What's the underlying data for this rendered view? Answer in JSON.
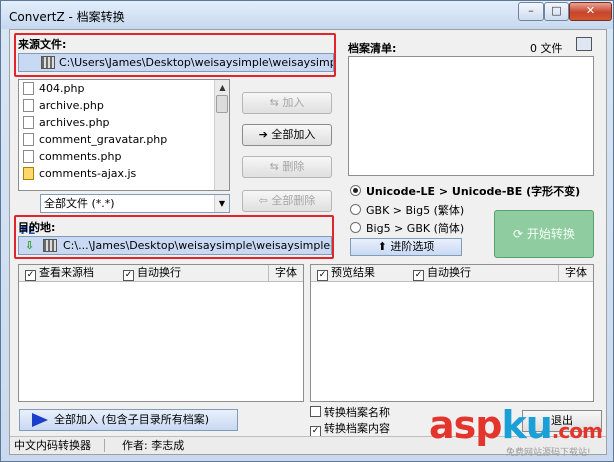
{
  "window": {
    "title": "ConvertZ - 档案转换",
    "minimize_glyph": "–",
    "maximize_glyph": "□",
    "close_glyph": "✕"
  },
  "source": {
    "label": "来源文件:",
    "path": "C:\\Users\\James\\Desktop\\weisaysimple\\weisaysimple",
    "files": [
      "404.php",
      "archive.php",
      "archives.php",
      "comment_gravatar.php",
      "comments.php",
      "comments-ajax.js"
    ],
    "filter_label": "FE",
    "filter_value": "全部文件 (*.*)"
  },
  "actions": {
    "add": "加入",
    "add_all": "全部加入",
    "remove": "删除",
    "remove_all": "全部删除"
  },
  "file_list": {
    "label": "档案清单:",
    "count": "0 文件"
  },
  "conversion": {
    "options": [
      "Unicode-LE > Unicode-BE (字形不变)",
      "GBK > Big5  (繁体)",
      "Big5 > GBK  (简体)"
    ],
    "selected_index": 0,
    "advanced": "进阶选项",
    "start": "开始转换"
  },
  "destination": {
    "label": "目的地:",
    "path": "C:\\...\\James\\Desktop\\weisaysimple\\weisaysimple-new"
  },
  "panes": {
    "left": {
      "view_source": "查看来源档",
      "wrap": "自动换行",
      "font": "字体"
    },
    "right": {
      "preview": "预览结果",
      "wrap": "自动换行",
      "font": "字体"
    }
  },
  "bottom": {
    "add_all_subdirs": "全部加入 (包含子目录所有档案)",
    "convert_name": "转换档案名称",
    "convert_content": "转换档案内容",
    "exit": "退出"
  },
  "status": {
    "app": "中文内码转换器",
    "author": "作者: 李志成"
  },
  "watermark": {
    "part1": "asp",
    "part2": "ku",
    "part3": ".com",
    "subtitle": "免费网站源码下载站!"
  }
}
